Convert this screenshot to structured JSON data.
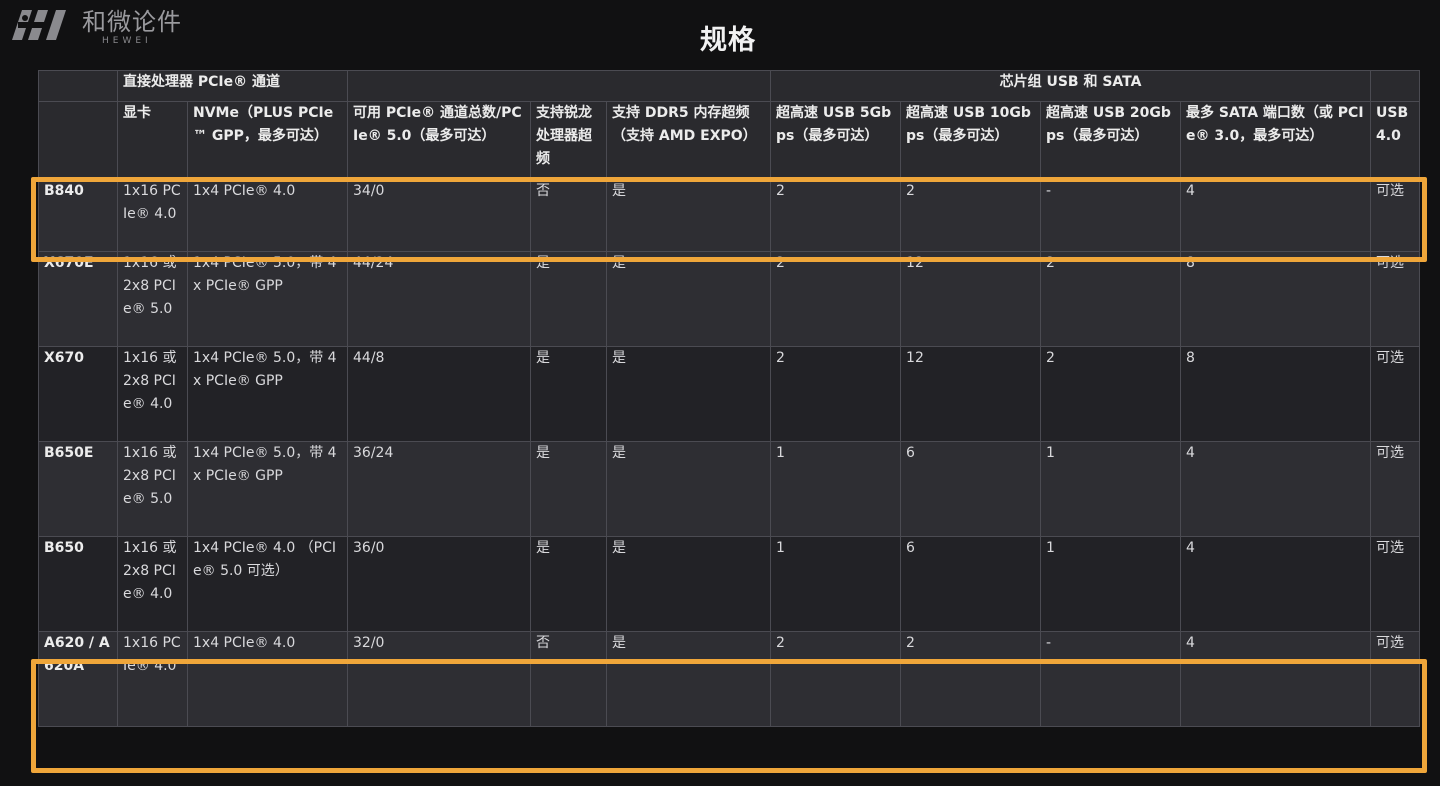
{
  "logo": {
    "text_cn": "和微论件",
    "text_en": "HEWEI"
  },
  "title": "规格",
  "table": {
    "group_headers": {
      "cpu_lanes": "直接处理器 PCIe® 通道",
      "chipset": "芯片组 USB 和 SATA"
    },
    "column_headers": [
      "",
      "显卡",
      "NVMe（PLUS PCIe™ GPP，最多可达）",
      "可用 PCIe® 通道总数/PCIe® 5.0（最多可达）",
      "支持锐龙处理器超频",
      "支持 DDR5 内存超频（支持 AMD EXPO）",
      "超高速 USB 5Gbps（最多可达）",
      "超高速 USB 10Gbps（最多可达）",
      "超高速 USB 20Gbps（最多可达）",
      "最多 SATA 端口数（或 PCIe® 3.0，最多可达）",
      "USB 4.0"
    ],
    "rows": [
      {
        "model": "B840",
        "gpu": "1x16 PCIe® 4.0",
        "nvme": "1x4 PCIe® 4.0",
        "lanes": "34/0",
        "cpu_oc": "否",
        "ddr5_oc": "是",
        "usb5": "2",
        "usb10": "2",
        "usb20": "-",
        "sata": "4",
        "usb4": "可选"
      },
      {
        "model": "X670E",
        "gpu": "1x16 或 2x8 PCIe® 5.0",
        "nvme": "1x4 PCIe® 5.0，带 4x PCIe® GPP",
        "lanes": "44/24",
        "cpu_oc": "是",
        "ddr5_oc": "是",
        "usb5": "2",
        "usb10": "12",
        "usb20": "2",
        "sata": "8",
        "usb4": "可选"
      },
      {
        "model": "X670",
        "gpu": "1x16 或 2x8 PCIe® 4.0",
        "nvme": "1x4 PCIe® 5.0，带 4x PCIe® GPP",
        "lanes": "44/8",
        "cpu_oc": "是",
        "ddr5_oc": "是",
        "usb5": "2",
        "usb10": "12",
        "usb20": "2",
        "sata": "8",
        "usb4": "可选"
      },
      {
        "model": "B650E",
        "gpu": "1x16 或 2x8 PCIe® 5.0",
        "nvme": "1x4 PCIe® 5.0，带 4x PCIe® GPP",
        "lanes": "36/24",
        "cpu_oc": "是",
        "ddr5_oc": "是",
        "usb5": "1",
        "usb10": "6",
        "usb20": "1",
        "sata": "4",
        "usb4": "可选"
      },
      {
        "model": "B650",
        "gpu": "1x16 或 2x8 PCIe® 4.0",
        "nvme": "1x4 PCIe® 4.0 （PCIe® 5.0 可选）",
        "lanes": "36/0",
        "cpu_oc": "是",
        "ddr5_oc": "是",
        "usb5": "1",
        "usb10": "6",
        "usb20": "1",
        "sata": "4",
        "usb4": "可选"
      },
      {
        "model": "A620 / A620A",
        "gpu": "1x16 PCIe® 4.0",
        "nvme": "1x4 PCIe® 4.0",
        "lanes": "32/0",
        "cpu_oc": "否",
        "ddr5_oc": "是",
        "usb5": "2",
        "usb10": "2",
        "usb20": "-",
        "sata": "4",
        "usb4": "可选"
      }
    ]
  },
  "colors": {
    "background": "#111112",
    "highlight": "#efa63a"
  }
}
